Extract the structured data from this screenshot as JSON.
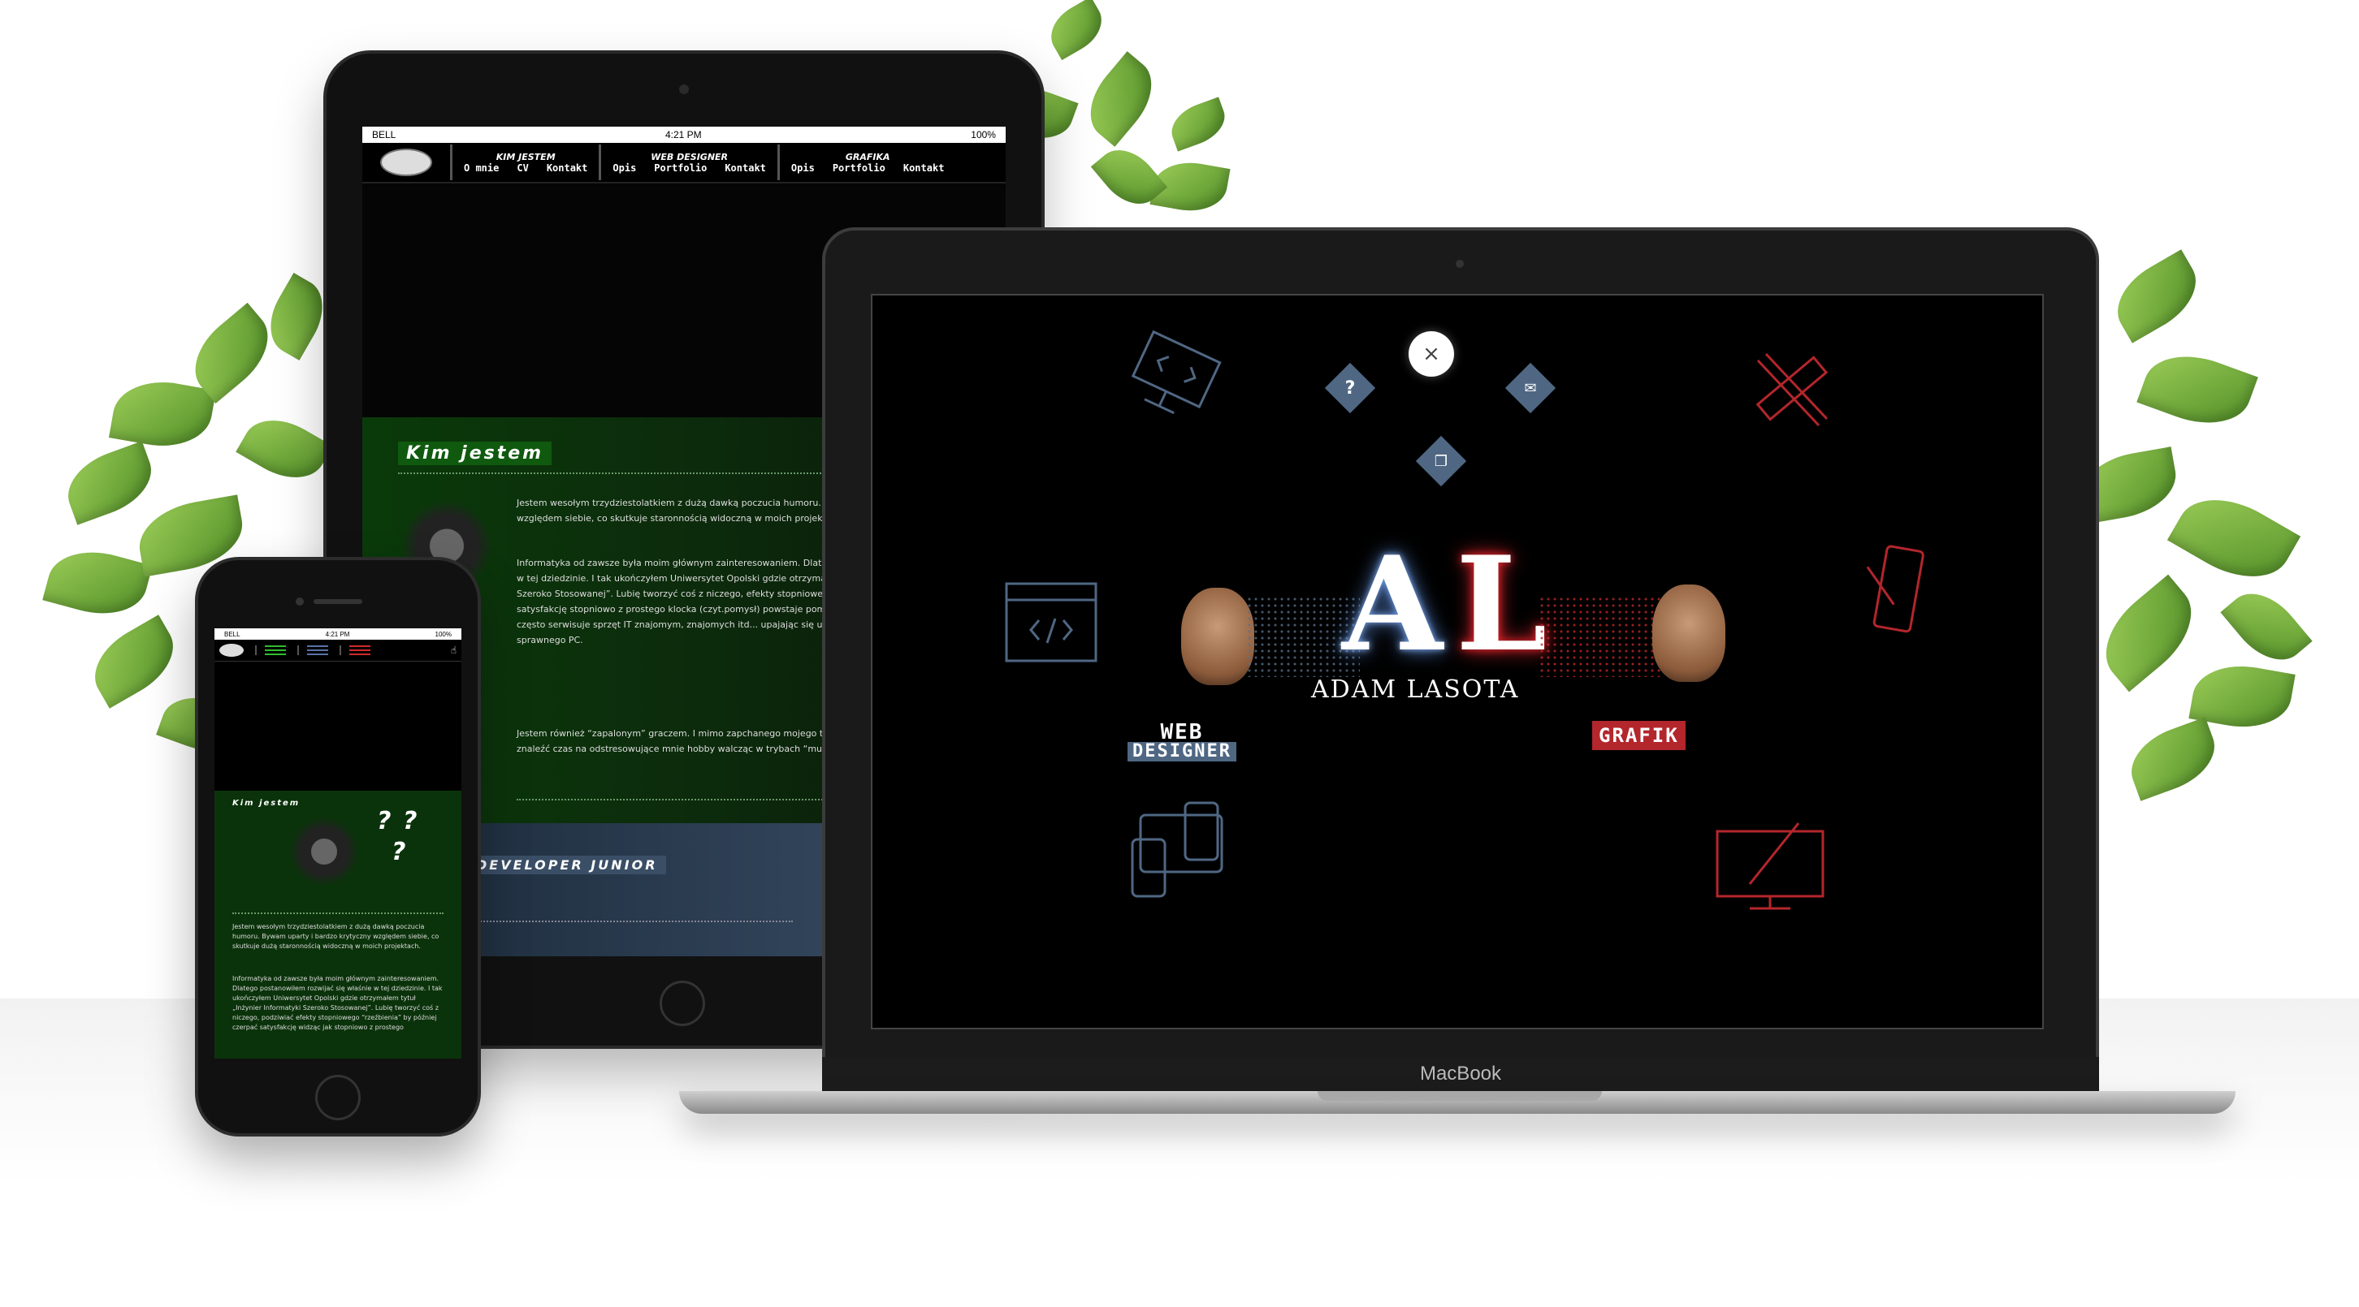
{
  "tablet": {
    "status": {
      "carrier": "BELL",
      "time": "4:21 PM",
      "battery": "100%"
    },
    "nav_groups": [
      {
        "title": "KIM JESTEM",
        "items": [
          "O mnie",
          "CV",
          "Kontakt"
        ]
      },
      {
        "title": "WEB DESIGNER",
        "items": [
          "Opis",
          "Portfolio",
          "Kontakt"
        ]
      },
      {
        "title": "GRAFIKA",
        "items": [
          "Opis",
          "Portfolio",
          "Kontakt"
        ]
      }
    ],
    "section_title": "Kim jestem",
    "paragraphs": [
      "Jestem wesołym trzydziestolatkiem z dużą dawką poczucia humoru. Bywam uparty i bardzo krytyczny względem siebie, co skutkuje staronnością widoczną w moich projektach.",
      "Informatyka od zawsze była moim głównym zainteresowaniem. Dlatego postanowiłem rozwijać się właśnie w tej dziedzinie. I tak ukończyłem Uniwersytet Opolski gdzie otrzymałem tytuł „Inżyniera Informatyki Szeroko Stosowanej”. Lubię tworzyć coś z niczego, efekty stopniowego “rzeźbienia” by później czerpać satysfakcję stopniowo z prostego klocka (czyt.pomysł) powstaje pomnik (czyt. efekt). W formie pomocy często serwisuje sprzęt IT znajomym, znajomych itd... upajając się udaną reanimacją skreślonego już nie sprawnego PC.",
      "Jestem również “zapalonym” graczem. I mimo zapchanego mojego tygodniowego planu zajęć, staram się znaleźć czas na odstresowujące mnie hobby walcząc w trybach “multiplayer” o ludzkości :)."
    ],
    "second_section": "DEVELOPER JUNIOR"
  },
  "phone": {
    "status": {
      "carrier": "BELL",
      "time": "4:21 PM",
      "battery": "100%"
    },
    "section_title": "Kim jestem",
    "question_marks": [
      "?",
      "?",
      "?"
    ],
    "paragraphs": [
      "Jestem wesołym trzydziestolatkiem z dużą dawką poczucia humoru. Bywam uparty i bardzo krytyczny względem siebie, co skutkuje dużą staronnością widoczną w moich projektach.",
      "Informatyka od zawsze była moim głównym zainteresowaniem. Dlatego postanowiłem rozwijać się właśnie w tej dziedzinie. I tak ukończyłem Uniwersytet Opolski gdzie otrzymałem tytuł „Inżynier Informatyki Szeroko Stosowanej”. Lubię tworzyć coś z niczego, podziwiać efekty stopniowego “rzeźbienia” by później czerpać satysfakcję widząc jak stopniowo z prostego"
    ],
    "hamburger_colors": [
      "#2fbf2f",
      "#5a73a8",
      "#d12a2a"
    ]
  },
  "laptop": {
    "brand": "MacBook",
    "close_label": "×",
    "help_label": "?",
    "mail_label": "✉",
    "window_label": "❐",
    "logo_left": "A",
    "logo_right": "L",
    "name": "ADAM LASOTA",
    "role_left_line1": "WEB",
    "role_left_line2": "DESIGNER",
    "role_right": "GRAFIK"
  },
  "colors": {
    "accent_red": "#e3262e",
    "accent_blue": "#4f6783",
    "accent_green": "#0f5a0f"
  }
}
